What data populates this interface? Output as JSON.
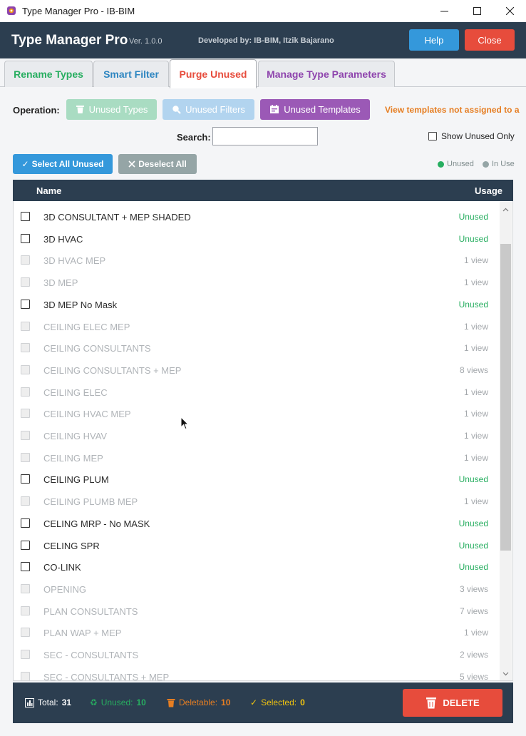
{
  "window": {
    "title": "Type Manager Pro - IB-BIM"
  },
  "header": {
    "title": "Type Manager Pro",
    "version": "Ver. 1.0.0",
    "developer": "Developed by: IB-BIM, Itzik Bajarano",
    "help_label": "Help",
    "close_label": "Close"
  },
  "tabs": [
    {
      "label": "Rename Types",
      "color": "#27ae60"
    },
    {
      "label": "Smart Filter",
      "color": "#2e86c1"
    },
    {
      "label": "Purge Unused",
      "color": "#e74c3c"
    },
    {
      "label": "Manage Type Parameters",
      "color": "#8e44ad"
    }
  ],
  "operation": {
    "label": "Operation:",
    "buttons": [
      "Unused Types",
      "Unused Filters",
      "Unused Templates"
    ],
    "description": "View templates not assigned to a"
  },
  "search": {
    "label": "Search:",
    "value": "",
    "placeholder": ""
  },
  "show_unused_only": {
    "label": "Show Unused Only",
    "checked": false
  },
  "selection": {
    "select_all_label": "Select All Unused",
    "deselect_all_label": "Deselect All"
  },
  "legend": {
    "unused": "Unused",
    "in_use": "In Use",
    "unused_color": "#27ae60",
    "in_use_color": "#95a5a6"
  },
  "list": {
    "col_name": "Name",
    "col_usage": "Usage",
    "rows": [
      {
        "name": "3D CONSULTANT + MEP SHADED",
        "usage": "Unused",
        "enabled": true
      },
      {
        "name": "3D HVAC",
        "usage": "Unused",
        "enabled": true
      },
      {
        "name": "3D HVAC MEP",
        "usage": "1 view",
        "enabled": false
      },
      {
        "name": "3D MEP",
        "usage": "1 view",
        "enabled": false
      },
      {
        "name": "3D MEP No Mask",
        "usage": "Unused",
        "enabled": true
      },
      {
        "name": "CEILING  ELEC MEP",
        "usage": "1 view",
        "enabled": false
      },
      {
        "name": "CEILING CONSULTANTS",
        "usage": "1 view",
        "enabled": false
      },
      {
        "name": "CEILING CONSULTANTS + MEP",
        "usage": "8 views",
        "enabled": false
      },
      {
        "name": "CEILING ELEC",
        "usage": "1 view",
        "enabled": false
      },
      {
        "name": "CEILING HVAC MEP",
        "usage": "1 view",
        "enabled": false
      },
      {
        "name": "CEILING HVAV",
        "usage": "1 view",
        "enabled": false
      },
      {
        "name": "CEILING MEP",
        "usage": "1 view",
        "enabled": false
      },
      {
        "name": "CEILING PLUM",
        "usage": "Unused",
        "enabled": true
      },
      {
        "name": "CEILING PLUMB MEP",
        "usage": "1 view",
        "enabled": false
      },
      {
        "name": "CELING MRP - No MASK",
        "usage": "Unused",
        "enabled": true
      },
      {
        "name": "CELING SPR",
        "usage": "Unused",
        "enabled": true
      },
      {
        "name": "CO-LINK",
        "usage": "Unused",
        "enabled": true
      },
      {
        "name": "OPENING",
        "usage": "3 views",
        "enabled": false
      },
      {
        "name": "PLAN CONSULTANTS",
        "usage": "7 views",
        "enabled": false
      },
      {
        "name": "PLAN WAP + MEP",
        "usage": "1 view",
        "enabled": false
      },
      {
        "name": "SEC - CONSULTANTS",
        "usage": "2 views",
        "enabled": false
      },
      {
        "name": "SEC - CONSULTANTS + MEP",
        "usage": "5 views",
        "enabled": false
      }
    ]
  },
  "footer": {
    "total_label": "Total:",
    "total": "31",
    "unused_label": "Unused:",
    "unused": "10",
    "deletable_label": "Deletable:",
    "deletable": "10",
    "selected_label": "Selected:",
    "selected": "0",
    "delete_label": "DELETE"
  }
}
